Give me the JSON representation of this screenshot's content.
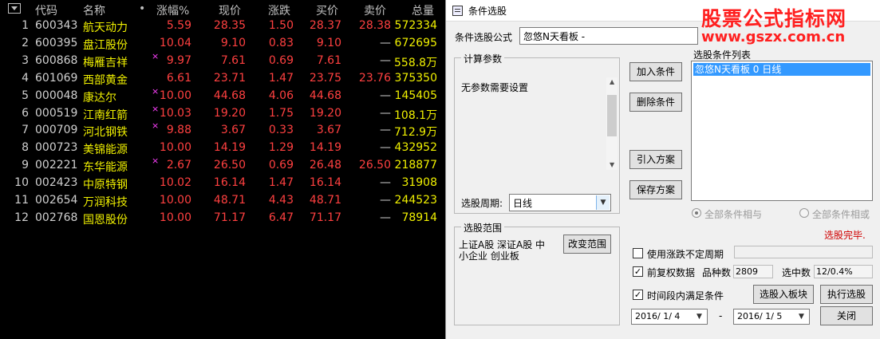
{
  "table": {
    "headers": {
      "code": "代码",
      "name": "名称",
      "dot": "•",
      "pct": "涨幅%",
      "price": "现价",
      "chg": "涨跌",
      "bid": "买价",
      "ask": "卖价",
      "vol": "总量"
    },
    "rows": [
      {
        "idx": "1",
        "code": "600343",
        "name": "航天动力",
        "mark": "",
        "pct": "5.59",
        "price": "28.35",
        "chg": "1.50",
        "bid": "28.37",
        "ask": "28.38",
        "vol": "572334"
      },
      {
        "idx": "2",
        "code": "600395",
        "name": "盘江股份",
        "mark": "",
        "pct": "10.04",
        "price": "9.10",
        "chg": "0.83",
        "bid": "9.10",
        "ask": "—",
        "vol": "672695"
      },
      {
        "idx": "3",
        "code": "600868",
        "name": "梅雁吉祥",
        "mark": "×",
        "pct": "9.97",
        "price": "7.61",
        "chg": "0.69",
        "bid": "7.61",
        "ask": "—",
        "vol": "558.8万"
      },
      {
        "idx": "4",
        "code": "601069",
        "name": "西部黄金",
        "mark": "",
        "pct": "6.61",
        "price": "23.71",
        "chg": "1.47",
        "bid": "23.75",
        "ask": "23.76",
        "vol": "375350"
      },
      {
        "idx": "5",
        "code": "000048",
        "name": "康达尔",
        "mark": "×",
        "pct": "10.00",
        "price": "44.68",
        "chg": "4.06",
        "bid": "44.68",
        "ask": "—",
        "vol": "145405"
      },
      {
        "idx": "6",
        "code": "000519",
        "name": "江南红箭",
        "mark": "×",
        "pct": "10.03",
        "price": "19.20",
        "chg": "1.75",
        "bid": "19.20",
        "ask": "—",
        "vol": "108.1万"
      },
      {
        "idx": "7",
        "code": "000709",
        "name": "河北钢铁",
        "mark": "×",
        "pct": "9.88",
        "price": "3.67",
        "chg": "0.33",
        "bid": "3.67",
        "ask": "—",
        "vol": "712.9万"
      },
      {
        "idx": "8",
        "code": "000723",
        "name": "美锦能源",
        "mark": "",
        "pct": "10.00",
        "price": "14.19",
        "chg": "1.29",
        "bid": "14.19",
        "ask": "—",
        "vol": "432952"
      },
      {
        "idx": "9",
        "code": "002221",
        "name": "东华能源",
        "mark": "×",
        "pct": "2.67",
        "price": "26.50",
        "chg": "0.69",
        "bid": "26.48",
        "ask": "26.50",
        "vol": "218877"
      },
      {
        "idx": "10",
        "code": "002423",
        "name": "中原特钢",
        "mark": "",
        "pct": "10.02",
        "price": "16.14",
        "chg": "1.47",
        "bid": "16.14",
        "ask": "—",
        "vol": "31908"
      },
      {
        "idx": "11",
        "code": "002654",
        "name": "万润科技",
        "mark": "",
        "pct": "10.00",
        "price": "48.71",
        "chg": "4.43",
        "bid": "48.71",
        "ask": "—",
        "vol": "244523"
      },
      {
        "idx": "12",
        "code": "002768",
        "name": "国恩股份",
        "mark": "",
        "pct": "10.00",
        "price": "71.17",
        "chg": "6.47",
        "bid": "71.17",
        "ask": "—",
        "vol": "78914"
      }
    ]
  },
  "dialog": {
    "title": "条件选股",
    "formula_label": "条件选股公式",
    "formula_value": "忽悠N天看板 -",
    "params_legend": "计算参数",
    "params_text": "无参数需要设置",
    "period_label": "选股周期:",
    "period_value": "日线",
    "add_btn": "加入条件",
    "del_btn": "删除条件",
    "import_btn": "引入方案",
    "save_btn": "保存方案",
    "list_label": "选股条件列表",
    "list_items": [
      "忽悠N天看板  0  日线"
    ],
    "radio_and": "全部条件相与",
    "radio_or": "全部条件相或",
    "status_text": "选股完毕.",
    "scope_legend": "选股范围",
    "scope_line1": "上证A股 深证A股 中",
    "scope_line2": "小企业 创业板",
    "change_scope_btn": "改变范围",
    "use_varperiod_label": "使用涨跌不定周期",
    "fq_label": "前复权数据",
    "count_label": "品种数",
    "count_value": "2809",
    "selected_label": "选中数",
    "selected_value": "12/0.4%",
    "time_cond_label": "时间段内满足条件",
    "to_block_btn": "选股入板块",
    "run_btn": "执行选股",
    "date_from": "2016/ 1/ 4",
    "date_sep": "-",
    "date_to": "2016/ 1/ 5",
    "close_btn": "关闭",
    "watermark_cn": "股票公式指标网",
    "watermark_url": "www.gszx.com.cn",
    "colors": {
      "up": "#ff4040",
      "name": "#f0f000",
      "selection": "#3399ff",
      "watermark": "#ff2020"
    }
  }
}
